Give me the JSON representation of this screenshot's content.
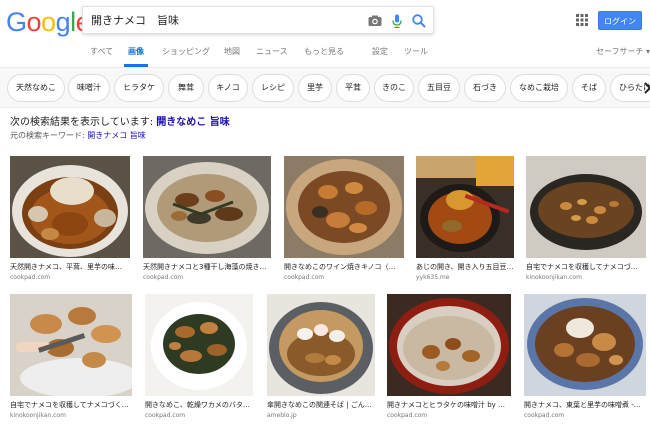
{
  "logo": {
    "letters": [
      "G",
      "o",
      "o",
      "g",
      "l",
      "e"
    ],
    "colors": [
      "#4285F4",
      "#EA4335",
      "#FBBC05",
      "#4285F4",
      "#34A853",
      "#EA4335"
    ]
  },
  "search": {
    "query": "開きナメコ　旨味"
  },
  "header": {
    "login_label": "ログイン"
  },
  "tabs": [
    {
      "label": "すべて",
      "active": false
    },
    {
      "label": "画像",
      "active": true
    },
    {
      "label": "ショッピング",
      "active": false
    },
    {
      "label": "地図",
      "active": false
    },
    {
      "label": "ニュース",
      "active": false
    },
    {
      "label": "もっと見る",
      "active": false
    },
    {
      "label": "設定",
      "active": false
    },
    {
      "label": "ツール",
      "active": false
    }
  ],
  "safesearch": "セーフサーチ ▾",
  "chips": [
    "天然なめこ",
    "味噌汁",
    "ヒラタケ",
    "舞茸",
    "キノコ",
    "レシピ",
    "里芋",
    "平茸",
    "きのこ",
    "五目豆",
    "石づき",
    "なめこ栽培",
    "そば",
    "ひらたけ"
  ],
  "correction": {
    "prefix": "次の検索結果を表示しています: ",
    "corrected": "開きなめこ 旨味",
    "orig_prefix": "元の検索キーワード: ",
    "orig_query": "開きナメコ 旨味"
  },
  "results": [
    {
      "caption": "天然開きナメコ、平茸、里芋の味…",
      "source": "cookpad.com"
    },
    {
      "caption": "天然開きナメコと3種干し海藻の焼き…",
      "source": "cookpad.com"
    },
    {
      "caption": "開きなめこのワイン焼きキノコ（…",
      "source": "cookpad.com"
    },
    {
      "caption": "あじの開き、開き入り五目豆…",
      "source": "yyk635.me"
    },
    {
      "caption": "自宅でナメコを収穫してナメコづ…",
      "source": "kinokoonjikan.com"
    },
    {
      "caption": "自宅でナメコを収穫してナメコづく…",
      "source": "kinokoonjikan.com"
    },
    {
      "caption": "開きなめこ、乾燥ワカメのバタ…",
      "source": "cookpad.com"
    },
    {
      "caption": "傘開きなめこの関連そば | ごん…",
      "source": "ameblo.jp"
    },
    {
      "caption": "開きナメコとヒラタケの味噌汁 by …",
      "source": "cookpad.com"
    },
    {
      "caption": "開きナメコ、東葉と里芋の味噌煮 -…",
      "source": "cookpad.com"
    }
  ]
}
